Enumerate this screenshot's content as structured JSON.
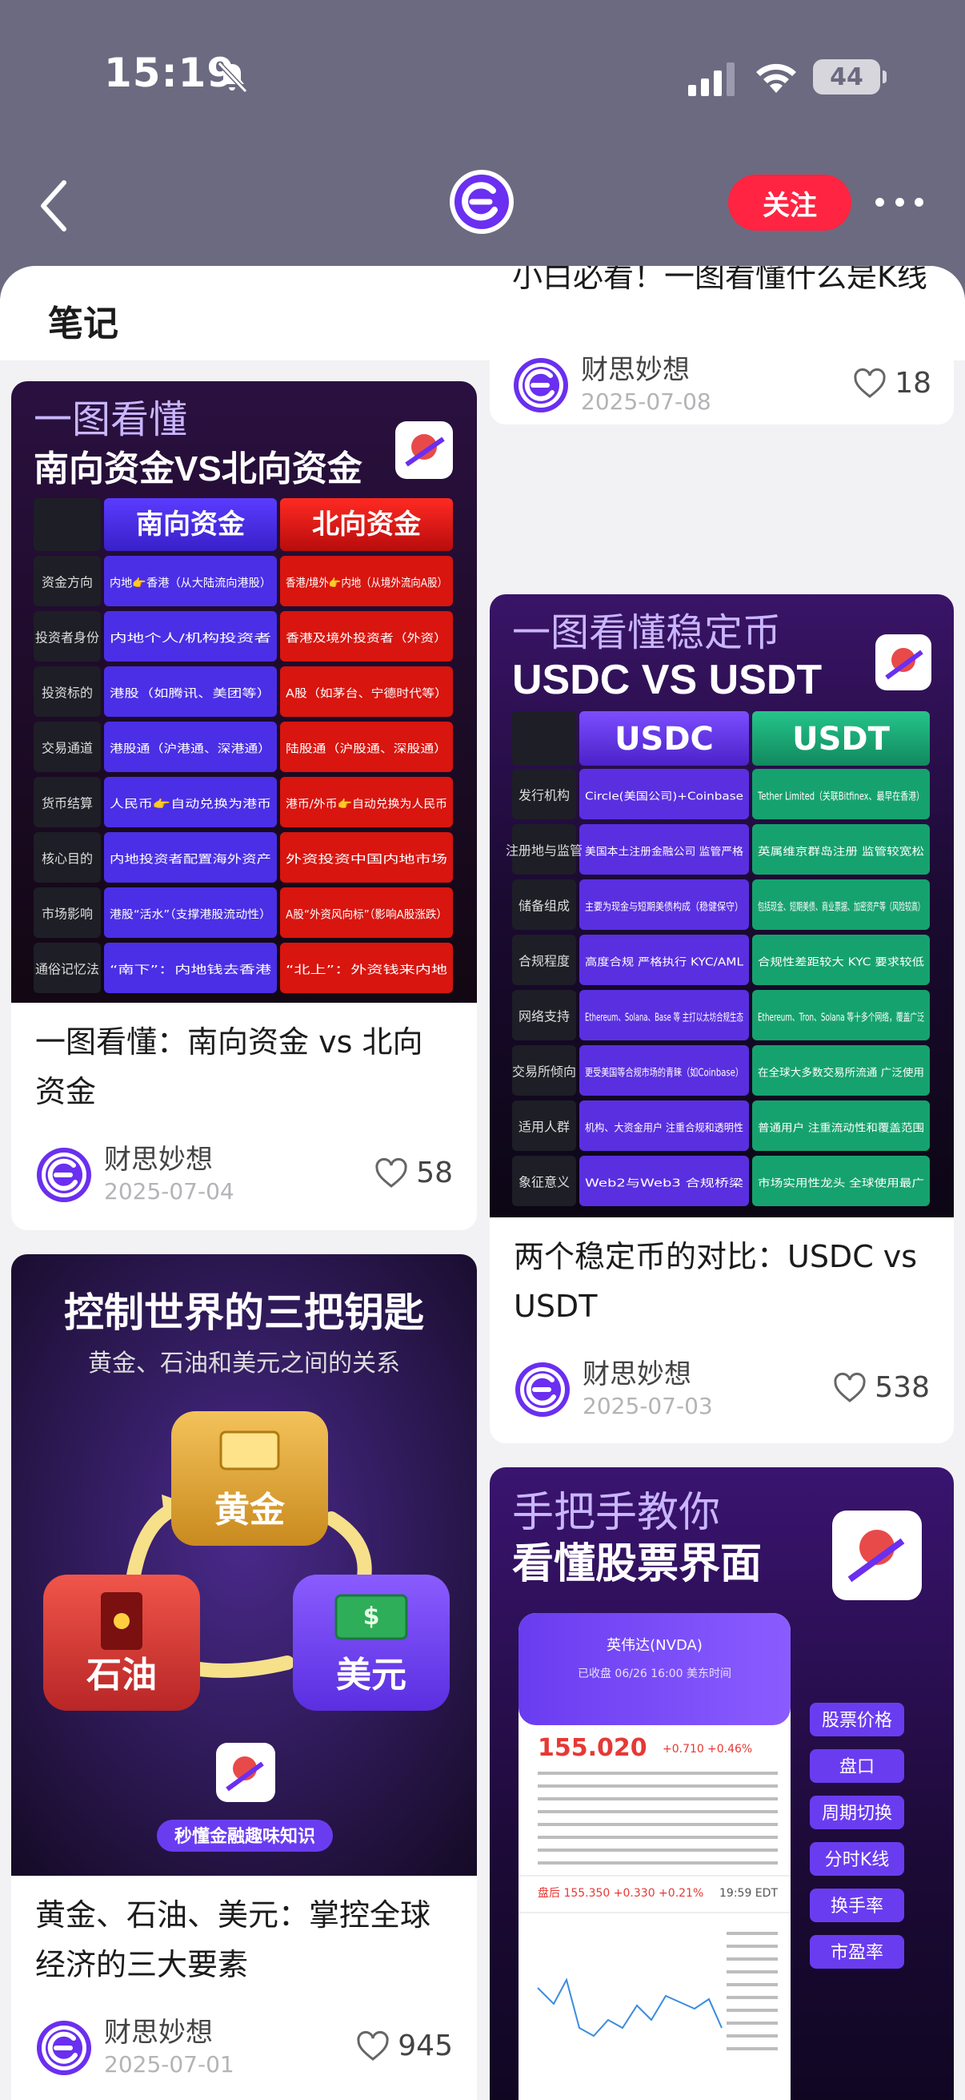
{
  "status_bar": {
    "time": "15:19",
    "battery": "44"
  },
  "nav": {
    "follow_label": "关注"
  },
  "sheet": {
    "title": "笔记"
  },
  "cards": [
    {
      "id": "north-south",
      "cover": {
        "line1": "一图看懂",
        "line2": "南向资金VS北向资金",
        "col_a": "南向资金",
        "col_b": "北向资金",
        "rows": [
          {
            "label": "资金方向",
            "a": "内地👉香港（从大陆流向港股）",
            "b": "香港/境外👉内地（从境外流向A股）"
          },
          {
            "label": "投资者身份",
            "a": "内地个人/机构投资者",
            "b": "香港及境外投资者（外资）"
          },
          {
            "label": "投资标的",
            "a": "港股（如腾讯、美团等）",
            "b": "A股（如茅台、宁德时代等）"
          },
          {
            "label": "交易通道",
            "a": "港股通（沪港通、深港通）",
            "b": "陆股通（沪股通、深股通）"
          },
          {
            "label": "货币结算",
            "a": "人民币👉自动兑换为港币",
            "b": "港币/外币👉自动兑换为人民币"
          },
          {
            "label": "核心目的",
            "a": "内地投资者配置海外资产",
            "b": "外资投资中国内地市场"
          },
          {
            "label": "市场影响",
            "a": "港股“活水”（支撑港股流动性）",
            "b": "A股“外资风向标”（影响A股涨跌）"
          },
          {
            "label": "通俗记忆法",
            "a": "“南下”：内地钱去香港",
            "b": "“北上”：外资钱来内地"
          }
        ]
      },
      "title": "一图看懂：南向资金 vs 北向资金",
      "author": "财思妙想",
      "date": "2025-07-04",
      "likes": "58"
    },
    {
      "id": "kline",
      "title": "小白必看！一图看懂什么是K线",
      "author": "财思妙想",
      "date": "2025-07-08",
      "likes": "18"
    },
    {
      "id": "usdc-usdt",
      "cover": {
        "line1": "一图看懂稳定币",
        "line2": "USDC VS USDT",
        "col_a": "USDC",
        "col_b": "USDT",
        "rows": [
          {
            "label": "发行机构",
            "a": "Circle(美国公司)+Coinbase",
            "b": "Tether Limited（关联Bitfinex、最早在香港）"
          },
          {
            "label": "注册地与监管",
            "a": "美国本土注册金融公司 监管严格",
            "b": "英属维京群岛注册 监管较宽松"
          },
          {
            "label": "储备组成",
            "a": "主要为现金与短期美债构成（稳健保守）",
            "b": "包括现金、短期美债、商业票据、加密资产等（风险较高）"
          },
          {
            "label": "合规程度",
            "a": "高度合规 严格执行 KYC/AML",
            "b": "合规性差距较大 KYC 要求较低"
          },
          {
            "label": "网络支持",
            "a": "Ethereum、Solana、Base 等 主打以太坊合规生态",
            "b": "Ethereum、Tron、Solana 等十多个网络，覆盖广泛"
          },
          {
            "label": "交易所倾向",
            "a": "更受美国等合规市场的青睐（如Coinbase）",
            "b": "在全球大多数交易所流通 广泛使用"
          },
          {
            "label": "适用人群",
            "a": "机构、大资金用户 注重合规和透明性",
            "b": "普通用户 注重流动性和覆盖范围"
          },
          {
            "label": "象征意义",
            "a": "Web2与Web3 合规桥梁",
            "b": "市场实用性龙头 全球使用最广"
          }
        ]
      },
      "title": "两个稳定币的对比：USDC vs USDT",
      "author": "财思妙想",
      "date": "2025-07-03",
      "likes": "538"
    },
    {
      "id": "three-keys",
      "cover": {
        "line1": "控制世界的三把钥匙",
        "line2": "黄金、石油和美元之间的关系",
        "gold": "黄金",
        "oil": "石油",
        "usd": "美元",
        "tagline": "秒懂金融趣味知识"
      },
      "title": "黄金、石油、美元：掌控全球经济的三大要素",
      "author": "财思妙想",
      "date": "2025-07-01",
      "likes": "945"
    },
    {
      "id": "stock-ui",
      "cover": {
        "line1": "手把手教你",
        "line2": "看懂股票界面",
        "phone_title": "英伟达(NVDA)",
        "phone_sub": "已收盘 06/26 16:00 美东时间",
        "price": "155.020",
        "change": "+0.710",
        "change_pct": "+0.46%",
        "after_hours": "盘后 155.350 +0.330 +0.21%",
        "after_time": "19:59 EDT",
        "tags": [
          "股票价格",
          "盘口",
          "周期切换",
          "分时K线",
          "换手率",
          "市盈率"
        ]
      }
    }
  ]
}
